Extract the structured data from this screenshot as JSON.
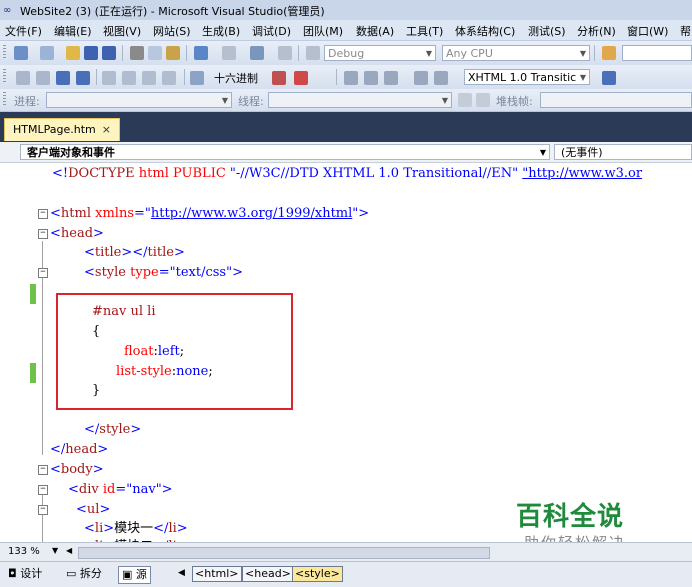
{
  "window": {
    "title": "WebSite2 (3) (正在运行) - Microsoft Visual Studio(管理员)",
    "logo": "∞"
  },
  "menu": [
    "文件(F)",
    "编辑(E)",
    "视图(V)",
    "网站(S)",
    "生成(B)",
    "调试(D)",
    "团队(M)",
    "数据(A)",
    "工具(T)",
    "体系结构(C)",
    "测试(S)",
    "分析(N)",
    "窗口(W)",
    "帮"
  ],
  "toolbar1": {
    "config": "Debug",
    "platform": "Any CPU"
  },
  "toolbar2": {
    "format_label": "十六进制",
    "doctype": "XHTML 1.0 Transitic"
  },
  "toolbar3": {
    "process_label": "进程:",
    "thread_label": "线程:",
    "stack_label": "堆栈帧:"
  },
  "tab": {
    "name": "HTMLPage.htm",
    "close": "×"
  },
  "navigation": {
    "objects": "客户端对象和事件",
    "events": "(无事件)"
  },
  "code_lines": [
    "<!DOCTYPE html PUBLIC \"-//W3C//DTD XHTML 1.0 Transitional//EN\" \"http://www.w3.or",
    "",
    "<html xmlns=\"http://www.w3.org/1999/xhtml\">",
    "<head>",
    "    <title></title>",
    "    <style type=\"text/css\">",
    "",
    "    #nav ul li",
    "    {",
    "        float:left;",
    "      list-style:none;",
    "    }",
    "",
    "    </style>",
    "</head>",
    "<body>",
    "  <div id=\"nav\">",
    "   <ul>",
    "     <li>模块一</li>",
    "     <li>模块二</li>"
  ],
  "editor": {
    "zoom": "133 %"
  },
  "watermark": {
    "title": "百科全说",
    "subtitle": "助你轻松解决"
  },
  "status": {
    "views": [
      "设计",
      "拆分",
      "源"
    ],
    "breadcrumbs": [
      "<html>",
      "<head>",
      "<style>"
    ]
  }
}
